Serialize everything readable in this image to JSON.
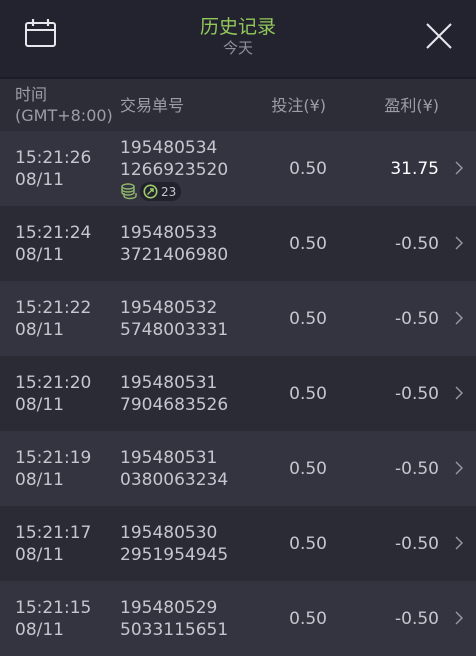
{
  "header": {
    "title": "历史记录",
    "subtitle": "今天",
    "calendar_icon": "calendar-icon",
    "close_icon": "close-icon"
  },
  "columns": {
    "time_line1": "时间",
    "time_line2": "(GMT+8:00)",
    "order": "交易单号",
    "stake": "投注(¥)",
    "profit": "盈利(¥)"
  },
  "rows": [
    {
      "time": "15:21:26",
      "date": "08/11",
      "id1": "195480534",
      "id2": "1266923520",
      "stake": "0.50",
      "profit": "31.75",
      "badge_count": "23"
    },
    {
      "time": "15:21:24",
      "date": "08/11",
      "id1": "195480533",
      "id2": "3721406980",
      "stake": "0.50",
      "profit": "-0.50"
    },
    {
      "time": "15:21:22",
      "date": "08/11",
      "id1": "195480532",
      "id2": "5748003331",
      "stake": "0.50",
      "profit": "-0.50"
    },
    {
      "time": "15:21:20",
      "date": "08/11",
      "id1": "195480531",
      "id2": "7904683526",
      "stake": "0.50",
      "profit": "-0.50"
    },
    {
      "time": "15:21:19",
      "date": "08/11",
      "id1": "195480531",
      "id2": "0380063234",
      "stake": "0.50",
      "profit": "-0.50"
    },
    {
      "time": "15:21:17",
      "date": "08/11",
      "id1": "195480530",
      "id2": "2951954945",
      "stake": "0.50",
      "profit": "-0.50"
    },
    {
      "time": "15:21:15",
      "date": "08/11",
      "id1": "195480529",
      "id2": "5033115651",
      "stake": "0.50",
      "profit": "-0.50"
    }
  ],
  "colors": {
    "accent": "#93c85a",
    "background": "#2b2b35",
    "header_bg": "#232330"
  }
}
